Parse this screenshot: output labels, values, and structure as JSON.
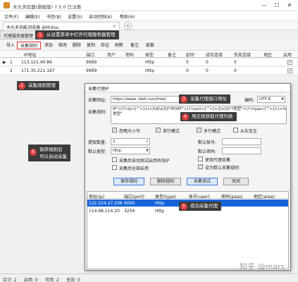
{
  "window": {
    "title": "木头浏览器(旗舰版) 7.5.0   已注册",
    "controls": [
      "—",
      "☐",
      "✕"
    ]
  },
  "menu": [
    "文件(F)",
    "编辑(E)",
    "书签(B)",
    "设置(S)",
    "自动控制(A)",
    "帮助(H)"
  ],
  "tab": {
    "label": "木头多功能浏览器 @Mutou",
    "close": "×",
    "add": "+"
  },
  "subtab": {
    "label": "代理服务器管理"
  },
  "toolbar": [
    "导入",
    "采集规则",
    "添加",
    "修改",
    "删除",
    "复制",
    "验证",
    "刷新",
    "备注",
    "嵌套"
  ],
  "columns": [
    "IP地址",
    "端口",
    "用户",
    "密码",
    "类型",
    "备注",
    "延时",
    "成功连接",
    "失败连接",
    "地区",
    "启用"
  ],
  "rows": [
    {
      "marker": "▶",
      "num": "1",
      "ip": "113.121.40.86",
      "port": "9999",
      "type": "Http",
      "delay": "0",
      "ok": "0",
      "fail": "0",
      "checked": true
    },
    {
      "marker": "",
      "num": "2",
      "ip": "171.35.221.167",
      "port": "9999",
      "type": "Http",
      "delay": "0",
      "ok": "0",
      "fail": "0",
      "checked": true
    }
  ],
  "callouts": {
    "c1": {
      "num": "1",
      "text": "从设置菜单中打开代理服务器管理"
    },
    "c2": {
      "num": "2",
      "text": "采集规则管理"
    },
    "c3": {
      "num": "3",
      "text": "采集代理接口地址"
    },
    "c4": {
      "num": "4",
      "text": "用正则获取代理列表"
    },
    "c5": {
      "num": "5",
      "text": "成功采集代理"
    },
    "c6": {
      "num": "6",
      "line1": "保存规则后",
      "line2": "可以自动采集"
    }
  },
  "dialog": {
    "title": "采集代理IP",
    "url_label": "采集网址:",
    "url_value": "https://www.        daili.com/free/",
    "encoding_label": "编码:",
    "encoding_value": "UTF-8",
    "regex_label": "采集规则:",
    "regex_line1": "IP\">(?<ip>[^<]+)</td[\\s\\S]*?PORT\">(?<port>[^<]+)[\\s\\S]*?类型\">(?<type>[^<]+)</td>[\\s\\S]*?",
    "regex_line2": "类型\"",
    "opt_ignore_case": "忽略大小写",
    "opt_single_line": "单行模式",
    "opt_multi_line": "多行模式",
    "opt_right_to_left": "从右至左",
    "count_label": "提取数量:",
    "count_value": "2",
    "type_label": "默认类型:",
    "type_value": "Http",
    "account_label": "默认帐号:",
    "password_label": "默认密码:",
    "chk_use_proxy": "使用代理采集",
    "chk_scheduled": "设为默认采集规则",
    "chk_auto_collect": "采集后自动测试启用有效IP",
    "chk_enable_all": "采集后全部启用",
    "btn_save": "保存规则",
    "btn_delete": "删除规则",
    "btn_collect": "采集测试",
    "btn_close": "关闭"
  },
  "proxy_columns": [
    "地址(ip)",
    "端口(port)",
    "类型(type)",
    "帐号(user)",
    "密码(pass)",
    "地区(area)"
  ],
  "proxy_rows": [
    {
      "ip": "122.224.27.206",
      "port": "9000",
      "type": "Http",
      "selected": true
    },
    {
      "ip": "114.98.114.20",
      "port": "3256",
      "type": "Http",
      "selected": false
    }
  ],
  "status": [
    "合计: 2",
    "启用: 0",
    "可用: 2",
    "无效: 0"
  ],
  "watermark": "知乎 @mars",
  "colors": {
    "highlight": "#e03030",
    "selection": "#1665d8",
    "callout_bg": "#3b3b3b",
    "badge": "#e04040"
  }
}
